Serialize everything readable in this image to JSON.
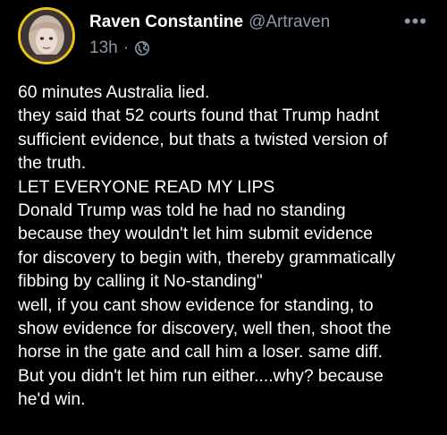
{
  "post": {
    "author": {
      "display_name": "Raven Constantine",
      "handle": "@Artraven",
      "avatar_icon": "profile-photo"
    },
    "timestamp": "13h",
    "separator": "·",
    "visibility_icon": "globe-icon",
    "more_label": "•••",
    "body_lines": [
      "60 minutes Australia lied.",
      "they said that 52 courts found that Trump hadnt",
      "sufficient evidence, but thats a twisted version of",
      "the truth.",
      "LET EVERYONE READ MY LIPS",
      "Donald Trump was told he had no standing",
      "because they wouldn't let him submit evidence",
      "for discovery to begin with, thereby grammatically",
      "fibbing by calling it No-standing\"",
      "well, if you cant show evidence for standing, to",
      "show evidence for discovery, well then, shoot the",
      "horse in the gate and call him a loser. same diff.",
      "But you didn't let him run either....why? because",
      "he'd win."
    ]
  },
  "colors": {
    "background": "#000000",
    "text_primary": "#ffffff",
    "text_secondary": "#8b98a5",
    "avatar_ring": "#e8c417"
  }
}
